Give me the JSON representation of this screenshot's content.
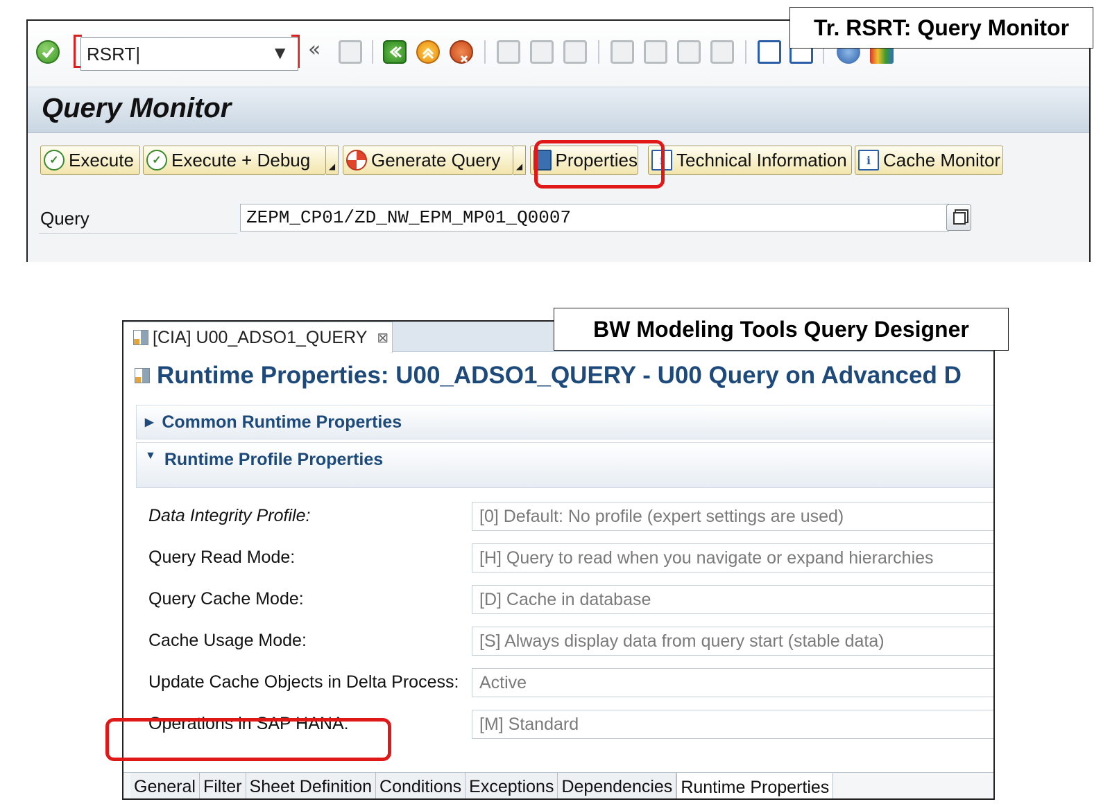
{
  "rsrt_panel": {
    "callout": "Tr. RSRT: Query Monitor",
    "command_field": "RSRT",
    "title": "Query Monitor",
    "buttons": [
      "Execute",
      "Execute + Debug",
      "Generate Query",
      "Properties",
      "Technical Information",
      "Cache Monitor"
    ],
    "query_label": "Query",
    "query_value": "ZEPM_CP01/ZD_NW_EPM_MP01_Q0007",
    "toolbar_icons": [
      "enter-icon",
      "back-icon",
      "exit-icon",
      "cancel-icon",
      "save-icon",
      "print-icon",
      "find-icon",
      "find-next-icon",
      "first-page-icon",
      "previous-page-icon",
      "next-page-icon",
      "last-page-icon",
      "create-session-icon",
      "shortcut-icon",
      "help-icon",
      "layout-icon"
    ]
  },
  "bw_panel": {
    "callout": "BW Modeling Tools Query Designer",
    "editor_tab": "[CIA] U00_ADSO1_QUERY",
    "title": "Runtime Properties: U00_ADSO1_QUERY - U00 Query on Advanced D",
    "sections": [
      "Common Runtime Properties",
      "Runtime Profile Properties"
    ],
    "properties": [
      {
        "label": "Data Integrity Profile:",
        "value": "[0] Default: No profile (expert settings are used)"
      },
      {
        "label": "Query Read Mode:",
        "value": "[H] Query to read when you navigate or expand hierarchies"
      },
      {
        "label": "Query Cache Mode:",
        "value": "[D] Cache in database"
      },
      {
        "label": "Cache Usage Mode:",
        "value": "[S] Always display data from query start (stable data)"
      },
      {
        "label": "Update Cache Objects in Delta Process:",
        "value": "Active"
      },
      {
        "label": "Operations in SAP HANA:",
        "value": "[M] Standard"
      }
    ],
    "bottom_tabs": [
      "General",
      "Filter",
      "Sheet Definition",
      "Conditions",
      "Exceptions",
      "Dependencies",
      "Runtime Properties"
    ],
    "active_tab": "Runtime Properties"
  },
  "colors": {
    "highlight": "#e01818",
    "title_blue": "#1d4a7a",
    "button_fill": "#f2e5ad"
  }
}
